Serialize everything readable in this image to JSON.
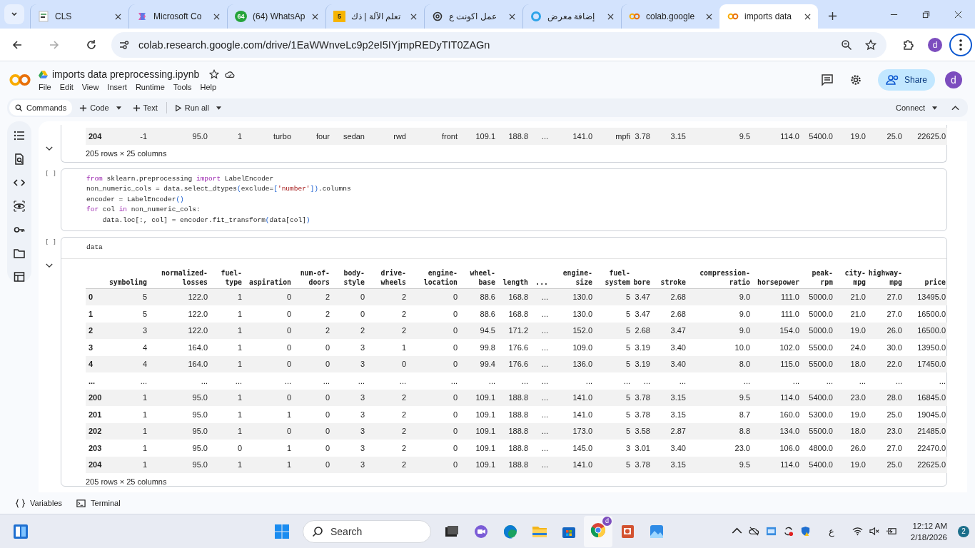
{
  "browser": {
    "tabs": [
      {
        "title": "CLS",
        "selected": false
      },
      {
        "title": "Microsoft Co",
        "selected": false
      },
      {
        "title": "(64) WhatsAp",
        "badge": "64",
        "selected": false
      },
      {
        "title": "تعلم الآلة | ذك",
        "badge": "5",
        "selected": false
      },
      {
        "title": "عمل اكونت ع",
        "selected": false
      },
      {
        "title": "إضافة معرض",
        "selected": false
      },
      {
        "title": "colab.google",
        "selected": false
      },
      {
        "title": "imports data",
        "selected": true
      }
    ],
    "address": "colab.research.google.com/drive/1EaWWnveLc9p2eI5IYjmpREDyTIT0ZAGn",
    "profile": "d"
  },
  "notebook": {
    "title": "imports data preprocessing.ipynb",
    "menu": [
      "File",
      "Edit",
      "View",
      "Insert",
      "Runtime",
      "Tools",
      "Help"
    ],
    "share": "Share",
    "avatar": "d",
    "toolbar": {
      "commands": "Commands",
      "code": "Code",
      "text": "Text",
      "run_all": "Run all",
      "connect": "Connect"
    }
  },
  "cells": [
    {
      "kind": "output",
      "rows": [
        [
          "204",
          "-1",
          "95.0",
          "1",
          "turbo",
          "four",
          "sedan",
          "rwd",
          "front",
          "109.1",
          "188.8",
          "...",
          "141.0",
          "mpfi",
          "3.78",
          "3.15",
          "9.5",
          "114.0",
          "5400.0",
          "19.0",
          "25.0",
          "22625.0"
        ]
      ],
      "caption": "205 rows × 25 columns"
    },
    {
      "kind": "code",
      "run_marker": "[ ]",
      "lines": [
        [
          {
            "t": "from",
            "kind": "kw"
          },
          {
            "t": " sklearn.preprocessing ",
            "kind": "plain"
          },
          {
            "t": "import",
            "kind": "kw"
          },
          {
            "t": " LabelEncoder",
            "kind": "plain"
          }
        ],
        [
          {
            "t": "non_numeric_cols = data.select_dtypes",
            "kind": "plain"
          },
          {
            "t": "(",
            "kind": "br"
          },
          {
            "t": "exclude=",
            "kind": "plain"
          },
          {
            "t": "[",
            "kind": "br"
          },
          {
            "t": "'number'",
            "kind": "str"
          },
          {
            "t": "]",
            "kind": "br"
          },
          {
            "t": ")",
            "kind": "br"
          },
          {
            "t": ".columns",
            "kind": "plain"
          }
        ],
        [
          {
            "t": "encoder = LabelEncoder",
            "kind": "plain"
          },
          {
            "t": "()",
            "kind": "br"
          }
        ],
        [
          {
            "t": "for",
            "kind": "kw"
          },
          {
            "t": " col ",
            "kind": "plain"
          },
          {
            "t": "in",
            "kind": "kw"
          },
          {
            "t": " non_numeric_cols:",
            "kind": "plain"
          }
        ],
        [
          {
            "t": "    data.loc[:, col] = encoder.fit_transform",
            "kind": "plain"
          },
          {
            "t": "(",
            "kind": "br"
          },
          {
            "t": "data[col]",
            "kind": "plain"
          },
          {
            "t": ")",
            "kind": "br"
          }
        ]
      ]
    },
    {
      "kind": "code_with_table",
      "run_marker": "[ ]",
      "lines": [
        [
          {
            "t": "data",
            "kind": "plain"
          }
        ]
      ],
      "columns": [
        "",
        "symboling",
        "normalized-losses",
        "fuel-type",
        "aspiration",
        "num-of-doors",
        "body-style",
        "drive-wheels",
        "engine-location",
        "wheel-base",
        "length",
        "...",
        "engine-size",
        "fuel-system",
        "bore",
        "stroke",
        "compression-ratio",
        "horsepower",
        "peak-rpm",
        "city-mpg",
        "highway-mpg",
        "price"
      ],
      "rows": [
        [
          "0",
          "5",
          "122.0",
          "1",
          "0",
          "2",
          "0",
          "2",
          "0",
          "88.6",
          "168.8",
          "...",
          "130.0",
          "5",
          "3.47",
          "2.68",
          "9.0",
          "111.0",
          "5000.0",
          "21.0",
          "27.0",
          "13495.0"
        ],
        [
          "1",
          "5",
          "122.0",
          "1",
          "0",
          "2",
          "0",
          "2",
          "0",
          "88.6",
          "168.8",
          "...",
          "130.0",
          "5",
          "3.47",
          "2.68",
          "9.0",
          "111.0",
          "5000.0",
          "21.0",
          "27.0",
          "16500.0"
        ],
        [
          "2",
          "3",
          "122.0",
          "1",
          "0",
          "2",
          "2",
          "2",
          "0",
          "94.5",
          "171.2",
          "...",
          "152.0",
          "5",
          "2.68",
          "3.47",
          "9.0",
          "154.0",
          "5000.0",
          "19.0",
          "26.0",
          "16500.0"
        ],
        [
          "3",
          "4",
          "164.0",
          "1",
          "0",
          "0",
          "3",
          "1",
          "0",
          "99.8",
          "176.6",
          "...",
          "109.0",
          "5",
          "3.19",
          "3.40",
          "10.0",
          "102.0",
          "5500.0",
          "24.0",
          "30.0",
          "13950.0"
        ],
        [
          "4",
          "4",
          "164.0",
          "1",
          "0",
          "0",
          "3",
          "0",
          "0",
          "99.4",
          "176.6",
          "...",
          "136.0",
          "5",
          "3.19",
          "3.40",
          "8.0",
          "115.0",
          "5500.0",
          "18.0",
          "22.0",
          "17450.0"
        ],
        [
          "...",
          "...",
          "...",
          "...",
          "...",
          "...",
          "...",
          "...",
          "...",
          "...",
          "...",
          "...",
          "...",
          "...",
          "...",
          "...",
          "...",
          "...",
          "...",
          "...",
          "...",
          "..."
        ],
        [
          "200",
          "1",
          "95.0",
          "1",
          "0",
          "0",
          "3",
          "2",
          "0",
          "109.1",
          "188.8",
          "...",
          "141.0",
          "5",
          "3.78",
          "3.15",
          "9.5",
          "114.0",
          "5400.0",
          "23.0",
          "28.0",
          "16845.0"
        ],
        [
          "201",
          "1",
          "95.0",
          "1",
          "1",
          "0",
          "3",
          "2",
          "0",
          "109.1",
          "188.8",
          "...",
          "141.0",
          "5",
          "3.78",
          "3.15",
          "8.7",
          "160.0",
          "5300.0",
          "19.0",
          "25.0",
          "19045.0"
        ],
        [
          "202",
          "1",
          "95.0",
          "1",
          "0",
          "0",
          "3",
          "2",
          "0",
          "109.1",
          "188.8",
          "...",
          "173.0",
          "5",
          "3.58",
          "2.87",
          "8.8",
          "134.0",
          "5500.0",
          "18.0",
          "23.0",
          "21485.0"
        ],
        [
          "203",
          "1",
          "95.0",
          "0",
          "1",
          "0",
          "3",
          "2",
          "0",
          "109.1",
          "188.8",
          "...",
          "145.0",
          "3",
          "3.01",
          "3.40",
          "23.0",
          "106.0",
          "4800.0",
          "26.0",
          "27.0",
          "22470.0"
        ],
        [
          "204",
          "1",
          "95.0",
          "1",
          "1",
          "0",
          "3",
          "2",
          "0",
          "109.1",
          "188.8",
          "...",
          "141.0",
          "5",
          "3.78",
          "3.15",
          "9.5",
          "114.0",
          "5400.0",
          "19.0",
          "25.0",
          "22625.0"
        ]
      ],
      "caption": "205 rows × 25 columns"
    }
  ],
  "bottom_bar": {
    "variables": "Variables",
    "terminal": "Terminal"
  },
  "taskbar": {
    "search": "Search",
    "chrome_badge": "d",
    "language": "ع",
    "time": "12:12 AM",
    "date": "2/18/2026",
    "notifications": "2"
  }
}
